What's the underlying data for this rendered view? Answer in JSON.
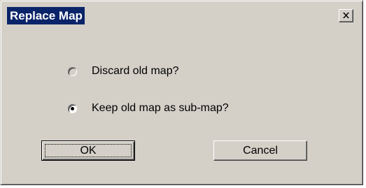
{
  "window": {
    "title": "Replace Map",
    "close_icon": "close-icon"
  },
  "options": [
    {
      "label": "Discard old map?",
      "selected": false
    },
    {
      "label": "Keep old map as sub-map?",
      "selected": true
    }
  ],
  "buttons": {
    "ok_label": "OK",
    "cancel_label": "Cancel"
  },
  "colors": {
    "title_highlight": "#0a246a",
    "face": "#d4d0c8"
  }
}
